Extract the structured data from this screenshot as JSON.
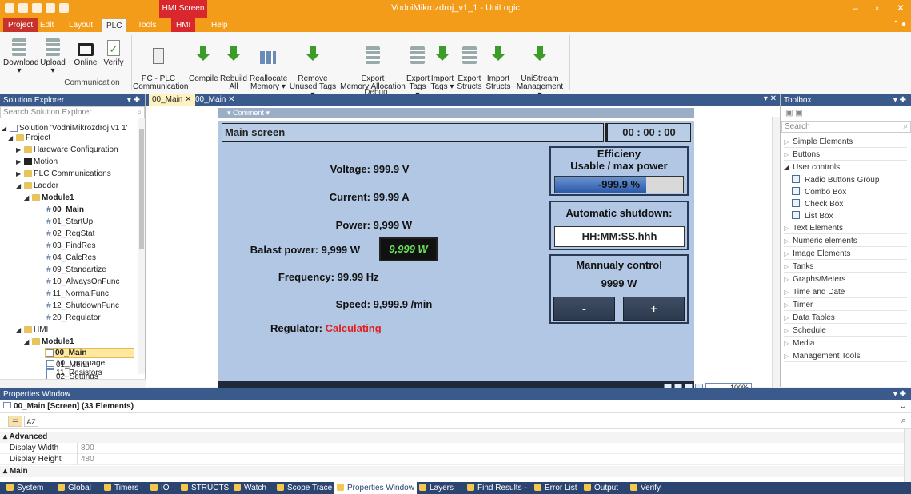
{
  "window": {
    "title": "VodniMikrozdroj_v1_1 - UniLogic",
    "context_tab": "HMI Screen"
  },
  "menu_tabs": [
    "Project",
    "Edit",
    "Layout",
    "PLC",
    "Tools",
    "HMI",
    "Help"
  ],
  "ribbon": {
    "buttons": [
      {
        "label": "Download",
        "icon": "download-icon"
      },
      {
        "label": "Upload",
        "icon": "upload-icon"
      },
      {
        "label": "Online",
        "icon": "online-icon"
      },
      {
        "label": "Verify",
        "icon": "verify-icon"
      },
      {
        "label": "PC - PLC\nCommunication",
        "icon": "pc-plc-icon"
      },
      {
        "label": "Compile",
        "icon": "compile-icon"
      },
      {
        "label": "Rebuild\nAll",
        "icon": "rebuild-icon"
      },
      {
        "label": "Reallocate\nMemory ▾",
        "icon": "reallocate-icon"
      },
      {
        "label": "Remove\nUnused Tags ▾",
        "icon": "remove-icon"
      },
      {
        "label": "Export\nMemory Allocation",
        "icon": "export-memory-icon"
      },
      {
        "label": "Export\nTags ▾",
        "icon": "export-tags-icon"
      },
      {
        "label": "Import\nTags ▾",
        "icon": "import-tags-icon"
      },
      {
        "label": "Export\nStructs",
        "icon": "export-structs-icon"
      },
      {
        "label": "Import\nStructs",
        "icon": "import-structs-icon"
      },
      {
        "label": "UniStream\nManagement ▾",
        "icon": "unistream-icon"
      }
    ],
    "groups": [
      "Communication",
      "Debug"
    ]
  },
  "solution_explorer": {
    "title": "Solution Explorer",
    "search_placeholder": "Search Solution Explorer",
    "items": [
      "Solution 'VodniMikrozdroj v1 1'",
      "Project",
      "Hardware Configuration",
      "Motion",
      "PLC Communications",
      "Ladder",
      "Module1",
      "00_Main",
      "01_StartUp",
      "02_RegStat",
      "03_FindRes",
      "04_CalcRes",
      "09_Standartize",
      "10_AlwaysOnFunc",
      "11_NormalFunc",
      "12_ShutdownFunc",
      "20_Regulator",
      "HMI",
      "Module1",
      "00_Main",
      "01_Menu",
      "02_Settings",
      "10_Language",
      "11_Resistors"
    ]
  },
  "doc_tabs": [
    "00_Main",
    "00_Main"
  ],
  "comment_label": "Comment",
  "hmi": {
    "title": "Main screen",
    "clock": "00 : 00 : 00",
    "rows": [
      {
        "label": "Voltage:",
        "value": "999.9 V"
      },
      {
        "label": "Current:",
        "value": "99.99 A"
      },
      {
        "label": "Power:",
        "value": "9,999 W"
      },
      {
        "label": "Balast power:",
        "value": "9,999 W"
      },
      {
        "label": "Frequency:",
        "value": "99.99 Hz"
      },
      {
        "label": "Speed:",
        "value": "9,999.9 /min"
      },
      {
        "label": "Regulator:",
        "value": "Calculating"
      }
    ],
    "balast_input": "9,999 W",
    "efficiency": {
      "title1": "Efficieny",
      "title2": "Usable / max power",
      "value": "-999.9 %",
      "fill_fraction": 0.71
    },
    "shutdown": {
      "title": "Automatic shutdown:",
      "value": "HH:MM:SS.hhh"
    },
    "manual": {
      "title": "Mannualy control",
      "value": "9999 W",
      "minus": "-",
      "plus": "+"
    },
    "zoom": "100%"
  },
  "toolbox": {
    "title": "Toolbox",
    "search_placeholder": "Search",
    "categories": [
      "Simple Elements",
      "Buttons",
      "User controls",
      "Radio Buttons Group",
      "Combo Box",
      "Check Box",
      "List Box",
      "Text Elements",
      "Numeric elements",
      "Image Elements",
      "Tanks",
      "Graphs/Meters",
      "Time and Date",
      "Timer",
      "Data Tables",
      "Schedule",
      "Media",
      "Management Tools"
    ]
  },
  "properties": {
    "title": "Properties Window",
    "selection": "00_Main [Screen] (33 Elements)",
    "categories": [
      "Advanced",
      "Main"
    ],
    "rows": [
      {
        "name": "Display Width",
        "value": "800"
      },
      {
        "name": "Display Height",
        "value": "480"
      }
    ]
  },
  "status_tabs": [
    "System",
    "Global",
    "Timers",
    "IO",
    "STRUCTS",
    "Watch",
    "Scope Trace",
    "Properties Window",
    "Layers",
    "Find Results -",
    "Error List",
    "Output",
    "Verify"
  ]
}
